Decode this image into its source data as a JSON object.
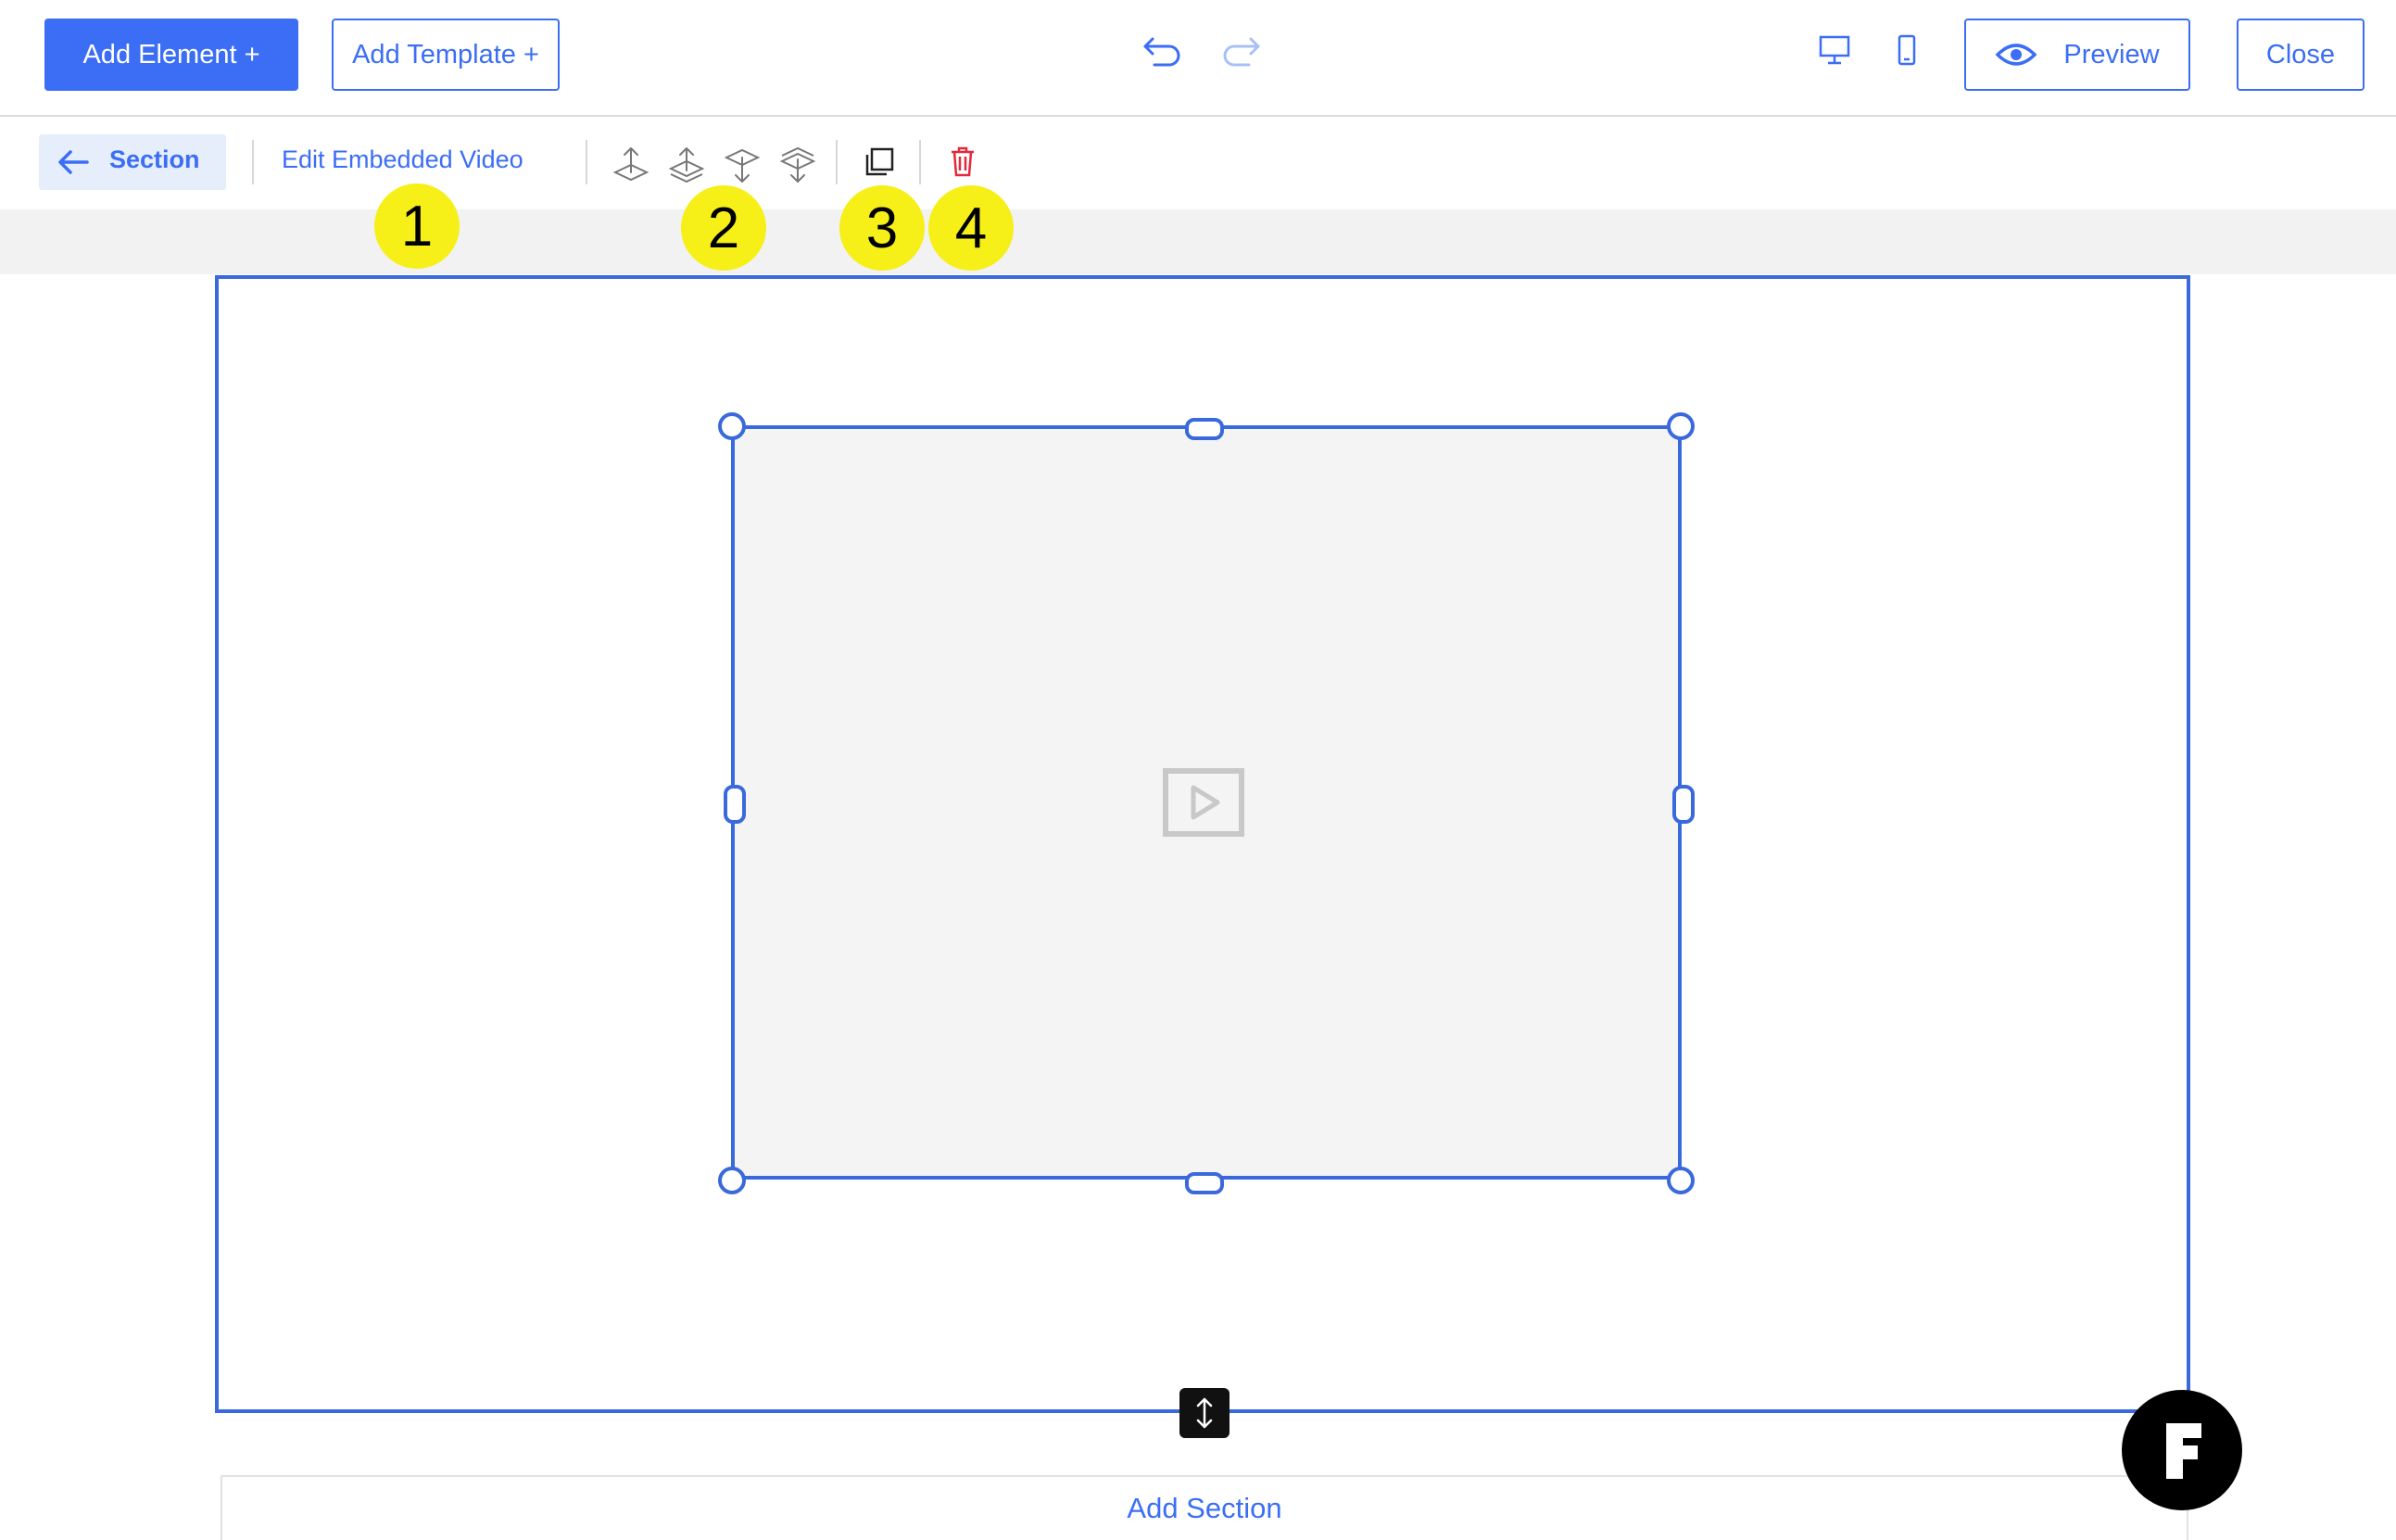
{
  "topbar": {
    "add_element_label": "Add Element +",
    "add_template_label": "Add Template +",
    "preview_label": "Preview",
    "close_label": "Close",
    "icons": [
      "undo-icon",
      "redo-icon",
      "desktop-icon",
      "mobile-icon",
      "eye-icon"
    ]
  },
  "toolbar": {
    "section_label": "Section",
    "edit_label": "Edit Embedded Video",
    "arrange_icons": [
      "bring-forward-icon",
      "bring-to-front-icon",
      "send-backward-icon",
      "send-to-back-icon"
    ],
    "duplicate_icon": "duplicate-icon",
    "delete_icon": "trash-icon"
  },
  "canvas": {
    "video_icon": "video-play-icon",
    "add_section_label": "Add Section"
  },
  "markers": [
    "1",
    "2",
    "3",
    "4"
  ],
  "colors": {
    "accent": "#3b6ef5",
    "selection": "#3a69dc",
    "delete": "#e5283a",
    "marker": "#f7ef18"
  }
}
